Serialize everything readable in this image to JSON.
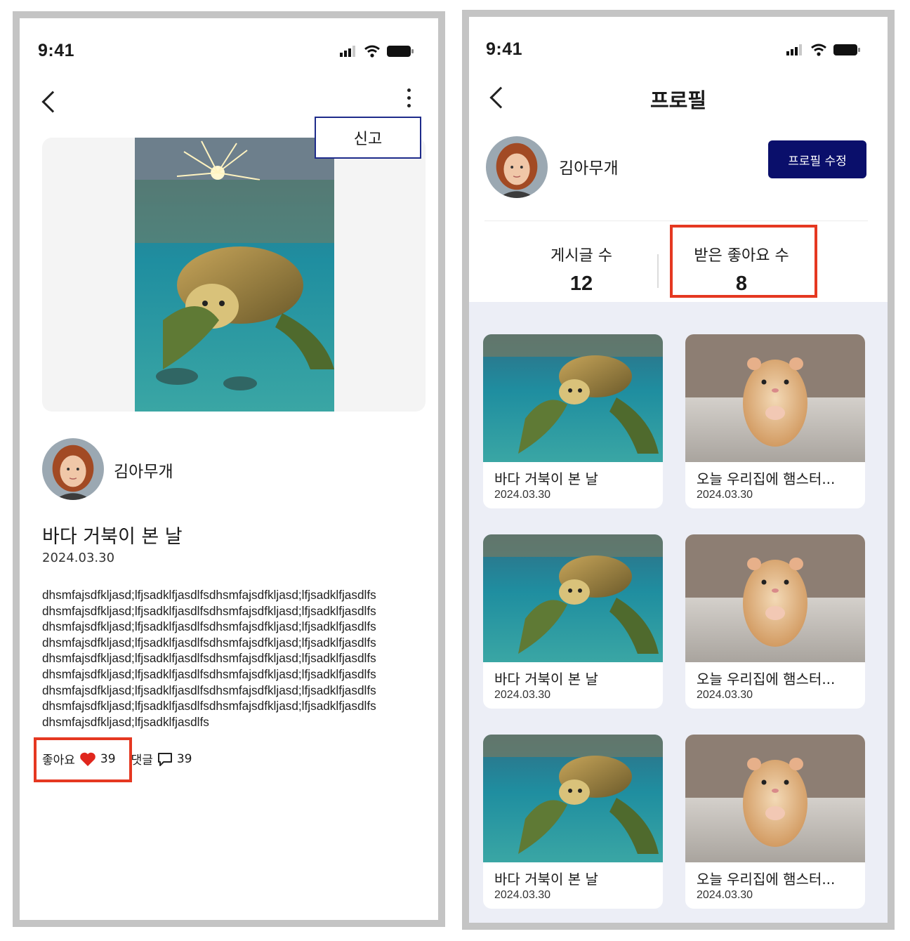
{
  "post_screen": {
    "status_time": "9:41",
    "report_label": "신고",
    "carousel_dots": 3,
    "active_dot": 0,
    "author_name": "김아무개",
    "title": "바다 거북이 본 날",
    "date": "2024.03.30",
    "body_lines": [
      "dhsmfajsdfkljasd;lfjsadklfjasdlfsdhsmfajsdfkljasd;lfjsadklfjasdlfs",
      "dhsmfajsdfkljasd;lfjsadklfjasdlfsdhsmfajsdfkljasd;lfjsadklfjasdlfs",
      "dhsmfajsdfkljasd;lfjsadklfjasdlfsdhsmfajsdfkljasd;lfjsadklfjasdlfs",
      "dhsmfajsdfkljasd;lfjsadklfjasdlfsdhsmfajsdfkljasd;lfjsadklfjasdlfs",
      "dhsmfajsdfkljasd;lfjsadklfjasdlfsdhsmfajsdfkljasd;lfjsadklfjasdlfs",
      "dhsmfajsdfkljasd;lfjsadklfjasdlfsdhsmfajsdfkljasd;lfjsadklfjasdlfs",
      "dhsmfajsdfkljasd;lfjsadklfjasdlfsdhsmfajsdfkljasd;lfjsadklfjasdlfs",
      "dhsmfajsdfkljasd;lfjsadklfjasdlfsdhsmfajsdfkljasd;lfjsadklfjasdlfs",
      "dhsmfajsdfkljasd;lfjsadklfjasdlfs"
    ],
    "like_label": "좋아요",
    "like_count": "39",
    "comment_label": "댓글",
    "comment_count": "39"
  },
  "profile_screen": {
    "status_time": "9:41",
    "title": "프로필",
    "user_name": "김아무개",
    "edit_button": "프로필 수정",
    "posts_label": "게시글 수",
    "posts_count": "12",
    "likes_label": "받은 좋아요 수",
    "likes_count": "8",
    "cards": [
      {
        "title": "바다 거북이 본 날",
        "date": "2024.03.30",
        "image": "turtle"
      },
      {
        "title": "오늘 우리집에 햄스터...",
        "date": "2024.03.30",
        "image": "hamster"
      },
      {
        "title": "바다 거북이 본 날",
        "date": "2024.03.30",
        "image": "turtle"
      },
      {
        "title": "오늘 우리집에 햄스터...",
        "date": "2024.03.30",
        "image": "hamster"
      },
      {
        "title": "바다 거북이 본 날",
        "date": "2024.03.30",
        "image": "turtle"
      },
      {
        "title": "오늘 우리집에 햄스터...",
        "date": "2024.03.30",
        "image": "hamster"
      }
    ]
  },
  "colors": {
    "accent_navy": "#0a0f6b",
    "highlight_red": "#e53821",
    "heart_red": "#e0261d",
    "grid_background": "#eceef6"
  }
}
